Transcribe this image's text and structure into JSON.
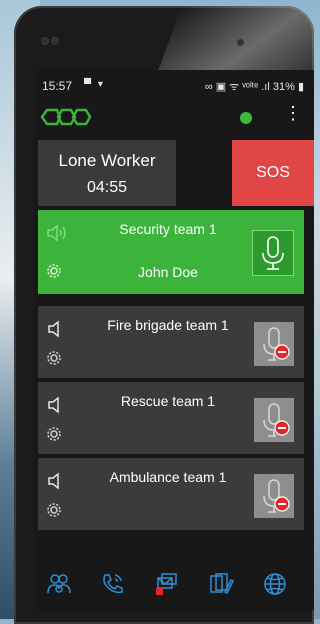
{
  "status_bar": {
    "time": "15:57",
    "battery": "31%"
  },
  "app": {
    "logo": "honeycomb-logo",
    "online_color": "#3dbb3d"
  },
  "lone_worker": {
    "label": "Lone Worker",
    "timer": "04:55"
  },
  "sos": {
    "label": "SOS",
    "color": "#e14646"
  },
  "teams": [
    {
      "name": "Security team 1",
      "user": "John Doe",
      "active": true
    },
    {
      "name": "Fire brigade team 1",
      "user": "",
      "active": false
    },
    {
      "name": "Rescue team 1",
      "user": "",
      "active": false
    },
    {
      "name": "Ambulance team 1",
      "user": "",
      "active": false
    }
  ],
  "bottom_nav": [
    {
      "icon": "contacts-icon"
    },
    {
      "icon": "call-icon"
    },
    {
      "icon": "messages-icon"
    },
    {
      "icon": "notes-icon"
    },
    {
      "icon": "globe-icon"
    }
  ],
  "colors": {
    "accent_green": "#3cb43c",
    "nav_blue": "#2f8fd6",
    "muted_red": "#e0262b"
  }
}
